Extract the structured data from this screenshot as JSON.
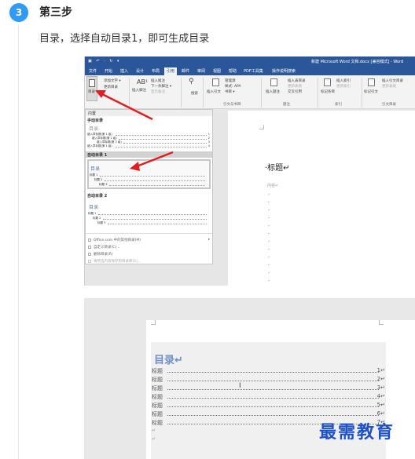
{
  "step": {
    "number": "3",
    "title": "第三步",
    "description": "目录，选择自动目录1，即可生成目录"
  },
  "word": {
    "title_bar": "新建 Microsoft Word 文档.docx [兼容模式] - Word",
    "quick_access": "▣ ↶ · ↻ ▾",
    "tabs": [
      "文件",
      "开始",
      "插入",
      "设计",
      "布局",
      "引用",
      "邮件",
      "审阅",
      "视图",
      "帮助",
      "PDF工具集",
      "操作说明搜索"
    ],
    "active_tab": "引用",
    "ribbon": {
      "toc_button": "目录",
      "add_text": "添加文字 ▾",
      "update_toc": "更新目录",
      "insert_footnote": "插入脚注",
      "insert_endnote": "插入尾注",
      "next_footnote": "下一条脚注 ▾",
      "show_notes": "显示备注",
      "search": "搜索",
      "insert_citation": "插入引文",
      "manage_sources": "管理源",
      "style": "样式: APA",
      "bibliography": "书目 ▾",
      "insert_caption": "插入题注",
      "insert_table_of_figures": "插入表目录",
      "update_table": "更新表格",
      "cross_reference": "交叉引用",
      "mark_entry": "标记条目",
      "insert_index": "插入索引",
      "update_index": "更新索引",
      "mark_citation": "标记引文",
      "insert_toa": "插入引文目录",
      "update_toa": "更新表格",
      "groups": [
        "引文与书目",
        "题注",
        "索引",
        "引文目录"
      ]
    },
    "dropdown": {
      "header": "内置",
      "manual_title": "手动目录",
      "toc_word": "目录",
      "manual_lines": [
        "键入章标题(第 1 级)",
        "键入章标题(第 2 级)",
        "键入章标题(第 3 级)",
        "键入章标题(第 1 级)"
      ],
      "manual_nums": [
        "1",
        "2",
        "3",
        "4"
      ],
      "auto1_title": "自动目录 1",
      "auto1_lines": [
        "标题 1",
        "标题 2",
        "标题 3"
      ],
      "auto2_title": "自动目录 2",
      "auto2_lines": [
        "标题 1",
        "标题 2",
        "标题 3"
      ],
      "menu": [
        "Office.com 中的其他目录(M)",
        "自定义目录(C)...",
        "删除目录(R)",
        "将所选内容保存到目录库(S)..."
      ]
    },
    "page": {
      "heading": "·标题↵",
      "content": "内容↵"
    }
  },
  "toc_result": {
    "title": "目录↵",
    "rows": [
      {
        "label": "标题",
        "num": "1↵"
      },
      {
        "label": "标题",
        "num": "2↵"
      },
      {
        "label": "标题",
        "num": "3↵"
      },
      {
        "label": "标题",
        "num": "4↵"
      },
      {
        "label": "标题",
        "num": "5↵"
      },
      {
        "label": "标题",
        "num": "6↵"
      },
      {
        "label": "标题",
        "num": "7↵"
      }
    ]
  },
  "watermark": "最需教育",
  "colors": {
    "badge": "#2f9bf4",
    "word_blue": "#2b579a",
    "arrow": "#e02020",
    "watermark": "#1e50c8"
  }
}
